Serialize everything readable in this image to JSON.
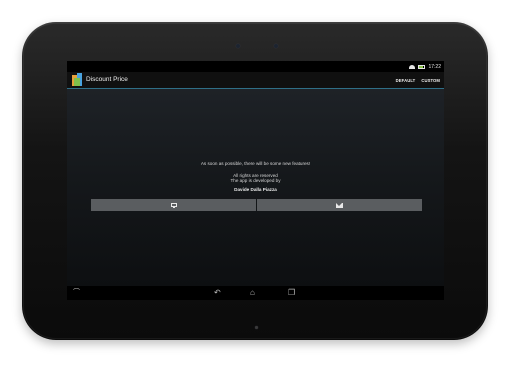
{
  "status_bar": {
    "time": "17:22"
  },
  "action_bar": {
    "title": "Discount Price",
    "actions": [
      "DEFAULT",
      "CUSTOM"
    ]
  },
  "content": {
    "line1": "As soon as possible, there will be some new features!",
    "line2": "All rights are reserved",
    "line3": "The app is developed by",
    "developer": "Davide Dalla Piazza"
  },
  "nav_bar": {
    "keyboard_glyph": "⌒",
    "back_glyph": "↶",
    "home_glyph": "⌂",
    "recent_glyph": "❐"
  },
  "colors": {
    "accent": "#2f6f87",
    "button": "#5a5d60",
    "background": "#000000"
  }
}
